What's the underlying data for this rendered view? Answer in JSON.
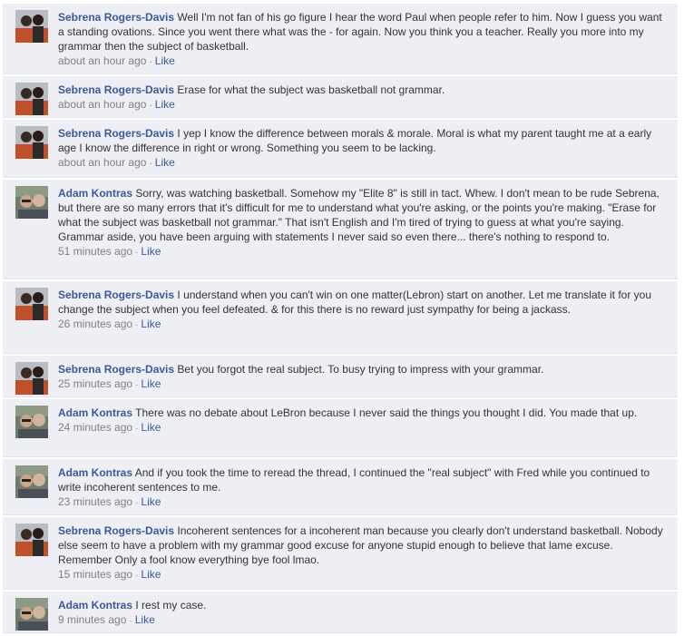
{
  "colors": {
    "link": "#3b5998",
    "bg": "#edeff4",
    "meta": "#808080",
    "text": "#333333"
  },
  "comments": [
    {
      "author": "Sebrena Rogers-Davis",
      "avatar": "sebrena-avatar",
      "text": "Well I'm not fan of his go figure I hear the word Paul when people refer to him. Now I guess you want a standing ovations. Since you went there what was the - for again. Now you think you a teacher. Really you more into my grammar then the subject of basketball.",
      "time": "about an hour ago",
      "dot": "·",
      "like": "Like"
    },
    {
      "author": "Sebrena Rogers-Davis",
      "avatar": "sebrena-avatar",
      "text": "Erase for what the subject was basketball not grammar.",
      "time": "about an hour ago",
      "dot": "·",
      "like": "Like"
    },
    {
      "author": "Sebrena Rogers-Davis",
      "avatar": "sebrena-avatar",
      "text": "I yep I know the difference between morals & morale. Moral is what my parent taught me at a early age I know the difference in right or wrong. Something you seem to be lacking.",
      "time": "about an hour ago",
      "dot": "·",
      "like": "Like"
    },
    {
      "author": "Adam Kontras",
      "avatar": "adam-avatar",
      "text": "Sorry, was watching basketball. Somehow my \"Elite 8\" is still in tact. Whew. I don't mean to be rude Sebrena, but there are so many errors that it's difficult for me to understand what you're asking, or the points you're making. \"Erase for what the subject was basketball not grammar.\" That isn't English and I'm tired of trying to guess at what you're saying. Grammar aside, you have been arguing with statements I never said so even there... there's nothing to respond to.",
      "time": "51 minutes ago",
      "dot": "·",
      "like": "Like"
    },
    {
      "author": "Sebrena Rogers-Davis",
      "avatar": "sebrena-avatar",
      "text": "I understand when you can't win on one matter(Lebron) start on another. Let me translate it for you change the subject when you feel defeated. & for this there is no reward just sympathy for being a jackass.",
      "time": "26 minutes ago",
      "dot": "·",
      "like": "Like"
    },
    {
      "author": "Sebrena Rogers-Davis",
      "avatar": "sebrena-avatar",
      "text": "Bet you forgot the real subject. To busy trying to impress with your grammar.",
      "time": "25 minutes ago",
      "dot": "·",
      "like": "Like"
    },
    {
      "author": "Adam Kontras",
      "avatar": "adam-avatar",
      "text": "There was no debate about LeBron because I never said the things you thought I did. You made that up.",
      "time": "24 minutes ago",
      "dot": "·",
      "like": "Like"
    },
    {
      "author": "Adam Kontras",
      "avatar": "adam-avatar",
      "text": "And if you took the time to reread the thread, I continued the \"real subject\" with Fred while you continued to write incoherent sentences to me.",
      "time": "23 minutes ago",
      "dot": "·",
      "like": "Like"
    },
    {
      "author": "Sebrena Rogers-Davis",
      "avatar": "sebrena-avatar",
      "text": "Incoherent sentences for a incoherent man because you clearly don't understand basketball. Nobody else seem to have a problem with my grammar good excuse for anyone stupid enough to believe that lame excuse. Remember Only a fool know everything bye fool lmao.",
      "time": "15 minutes ago",
      "dot": "·",
      "like": "Like"
    },
    {
      "author": "Adam Kontras",
      "avatar": "adam-avatar",
      "text": "I rest my case.",
      "time": "9 minutes ago",
      "dot": "·",
      "like": "Like"
    }
  ]
}
